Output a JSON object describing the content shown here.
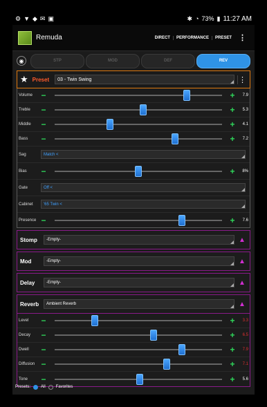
{
  "status": {
    "battery": "73%",
    "time": "11:27 AM"
  },
  "app": {
    "title": "Remuda",
    "menu": [
      "DIRECT",
      "PERFORMANCE",
      "PRESET"
    ]
  },
  "tabs": [
    "STP",
    "MOD",
    "DEF",
    "REV"
  ],
  "preset": {
    "label": "Preset",
    "value": "03 - Twin Swing"
  },
  "amp": {
    "sliders": [
      {
        "name": "Volume",
        "value": "7.9",
        "fraction": 0.79
      },
      {
        "name": "Treble",
        "value": "5.3",
        "fraction": 0.53
      },
      {
        "name": "Middle",
        "value": "4.1",
        "fraction": 0.33
      },
      {
        "name": "Bass",
        "value": "7.2",
        "fraction": 0.72
      }
    ],
    "sag": {
      "name": "Sag",
      "value": "Match <"
    },
    "bias": {
      "name": "Bias",
      "value": "8%",
      "fraction": 0.5
    },
    "gate": {
      "name": "Gate",
      "value": "Off <"
    },
    "cabinet": {
      "name": "Cabinet",
      "value": "'65 Twin <"
    },
    "presence": {
      "name": "Presence",
      "value": "7.6",
      "fraction": 0.76
    }
  },
  "stomp": {
    "name": "Stomp",
    "value": "-Empty-"
  },
  "mod": {
    "name": "Mod",
    "value": "-Empty-"
  },
  "delay": {
    "name": "Delay",
    "value": "-Empty-"
  },
  "reverb": {
    "name": "Reverb",
    "value": "Ambient Reverb",
    "sliders": [
      {
        "name": "Level",
        "value": "3.3",
        "fraction": 0.24,
        "red": true
      },
      {
        "name": "Decay",
        "value": "6.5",
        "fraction": 0.59,
        "red": true
      },
      {
        "name": "Dwell",
        "value": "7.9",
        "fraction": 0.76,
        "red": true
      },
      {
        "name": "Diffusion",
        "value": "7.1",
        "fraction": 0.67,
        "red": true
      },
      {
        "name": "Tone",
        "value": "5.6",
        "fraction": 0.51,
        "red": false
      }
    ]
  },
  "footer": {
    "label": "Presets:",
    "all": "All",
    "favorites": "Favorites"
  }
}
